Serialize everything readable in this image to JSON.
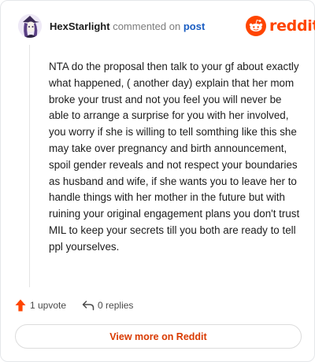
{
  "header": {
    "username": "HexStarlight",
    "action_text": "commented on",
    "post_link_label": "post",
    "brand_name": "reddit",
    "brand_color": "#ff4500",
    "avatar_icon": "witch-avatar-icon"
  },
  "comment": {
    "body": "NTA do the proposal then talk to your gf about exactly what happened, ( another day) explain that her mom broke your trust and not you feel you will never be able to arrange a surprise for you with her involved, you worry if she is willing to tell somthing like this she may take over pregnancy and birth announcement, spoil gender reveals and not respect your boundaries as husband and wife, if she wants you to leave her to handle things with her mother in the future but with ruining your original engagement plans you don't trust MIL to keep your secrets till you both are ready to tell ppl yourselves."
  },
  "actions": {
    "upvote_label": "1 upvote",
    "upvote_icon": "upvote-arrow-icon",
    "upvote_color": "#ff4500",
    "replies_label": "0 replies",
    "replies_icon": "reply-arrow-icon"
  },
  "footer": {
    "view_more_label": "View more on Reddit",
    "view_more_color": "#d93a00"
  }
}
